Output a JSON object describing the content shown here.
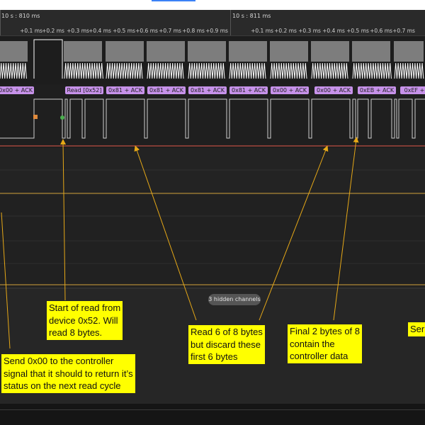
{
  "ruler": {
    "segments": [
      {
        "label": "10 s : 810 ms"
      },
      {
        "label": "10 s : 811 ms"
      }
    ],
    "ticks": [
      "+0.1 ms",
      "+0.2 ms",
      "+0.3 ms",
      "+0.4 ms",
      "+0.5 ms",
      "+0.6 ms",
      "+0.7 ms",
      "+0.8 ms",
      "+0.9 ms"
    ]
  },
  "decoder": {
    "frames": [
      "0x00 + ACK",
      "Read [0x52]",
      "0x81 + ACK",
      "0x81 + ACK",
      "0x81 + ACK",
      "0x81 + ACK",
      "0x00 + ACK",
      "0x00 + ACK",
      "0xEB + ACK",
      "0xEF +"
    ]
  },
  "hidden_channels": "3 hidden channels",
  "annotations": {
    "send": [
      "Send 0x00  to the controller",
      "signal that it should to return it’s",
      "status on the next read cycle"
    ],
    "start": [
      "Start of read from",
      "device 0x52. Will",
      "read 8 bytes."
    ],
    "read6": [
      "Read 6 of 8 bytes",
      "but discard these",
      "first 6 bytes"
    ],
    "final": [
      "Final 2 bytes of 8",
      "contain the",
      "controller data"
    ],
    "partial": "Seri"
  },
  "colors": {
    "clock": "#ffffff",
    "decoder_bubble": "#c792ea",
    "annotation_bg": "#ffff00",
    "arrow": "#e6a817",
    "channel_divider_red": "#e2584a",
    "channel_divider_orange": "#d2a23a",
    "marker_start": "#e08a3c",
    "marker_stop": "#4caf50"
  }
}
